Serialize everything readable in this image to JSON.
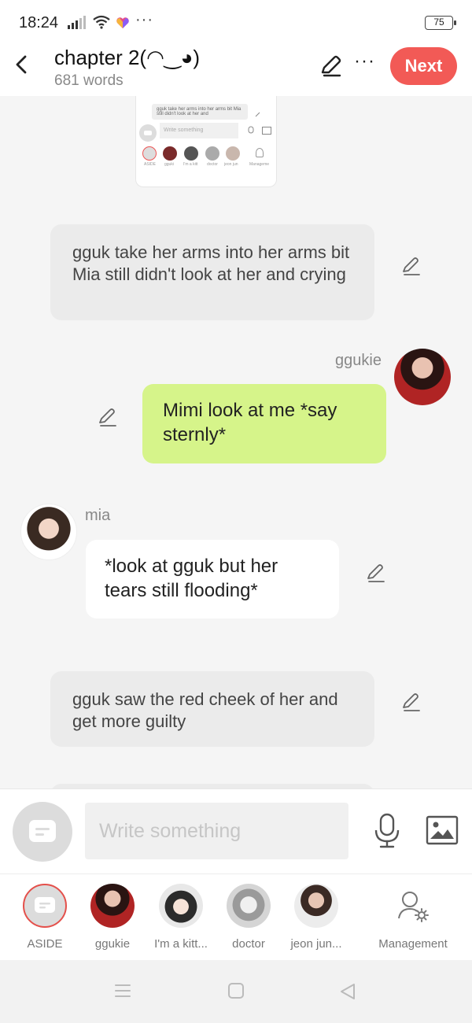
{
  "status": {
    "time": "18:24",
    "more": "···",
    "battery": "75"
  },
  "header": {
    "title": "chapter 2(◠‿◕)",
    "word_count": "681 words",
    "more": "···",
    "next_label": "Next"
  },
  "preview": {
    "bubble_text": "gguk take her arms into her arms bit Mia still didn't look at her and",
    "input_placeholder": "Write something",
    "chars": [
      "ASIDE",
      "gguki",
      "I'm a kitt",
      "doctor",
      "jeon jun",
      "Manageme"
    ]
  },
  "messages": [
    {
      "type": "aside",
      "text": "gguk take her arms into her arms bit Mia still didn't look at her and crying"
    },
    {
      "type": "right",
      "speaker": "ggukie",
      "text": "Mimi look at me *say sternly*"
    },
    {
      "type": "left",
      "speaker": "mia",
      "text": "*look at gguk but her tears still flooding*"
    },
    {
      "type": "aside",
      "text": "gguk saw the red cheek of her and get more guilty"
    }
  ],
  "composer": {
    "placeholder": "Write something"
  },
  "characters": [
    {
      "label": "ASIDE"
    },
    {
      "label": "ggukie"
    },
    {
      "label": "I'm a kitt..."
    },
    {
      "label": "doctor"
    },
    {
      "label": "jeon jun..."
    },
    {
      "label": "Management"
    }
  ],
  "colors": {
    "accent": "#f25a56",
    "right_bubble": "#d6f48a",
    "aside_bubble": "#ebebeb"
  }
}
